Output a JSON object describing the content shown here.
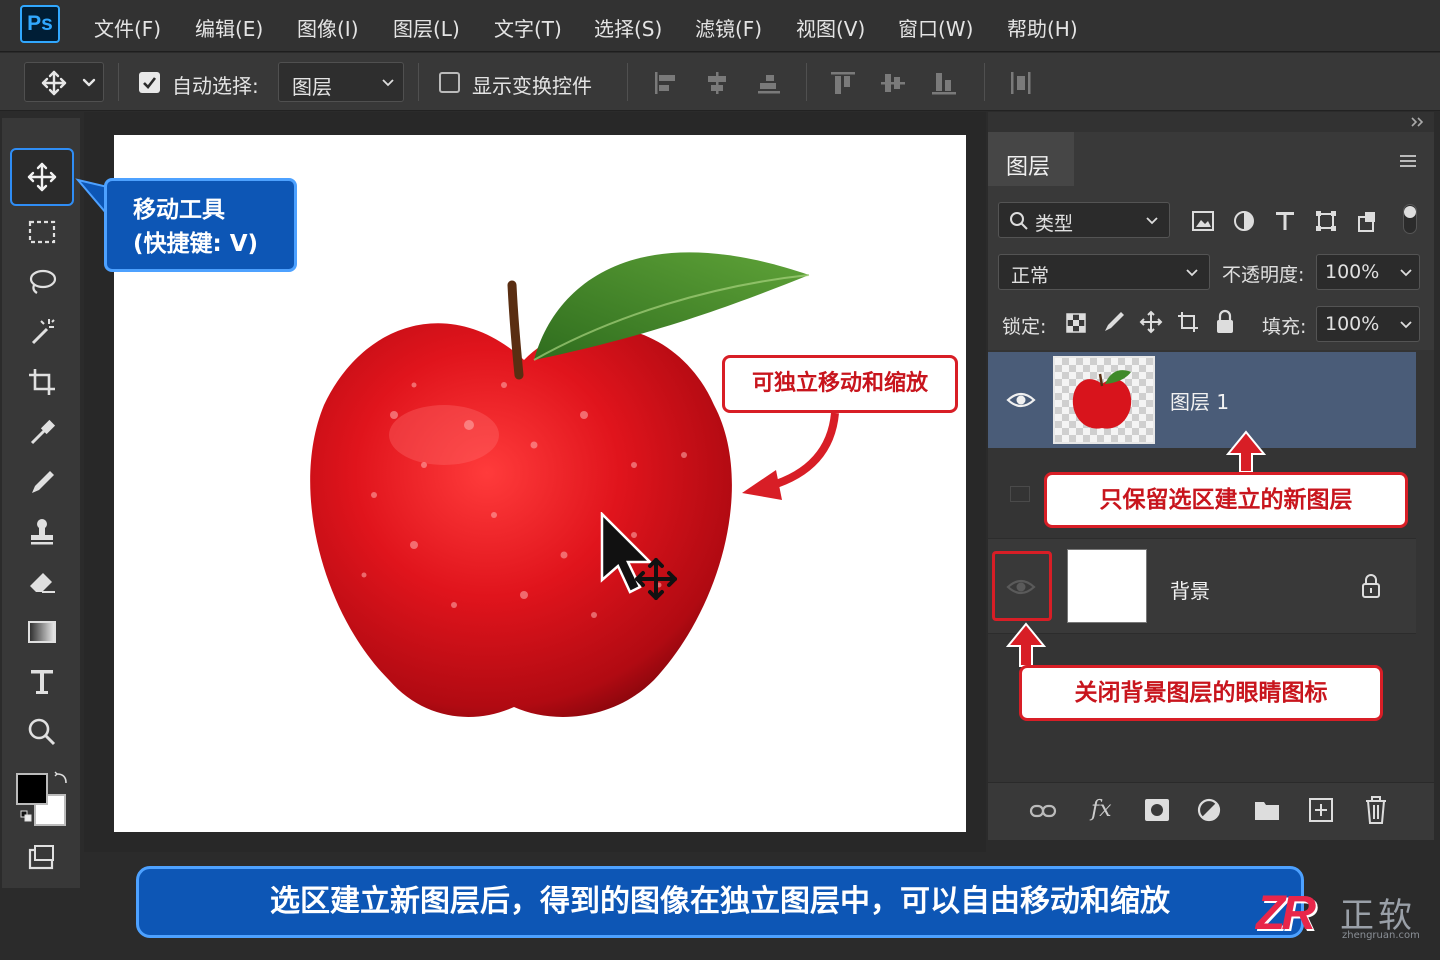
{
  "app": {
    "logo": "Ps"
  },
  "menu": [
    "文件(F)",
    "编辑(E)",
    "图像(I)",
    "图层(L)",
    "文字(T)",
    "选择(S)",
    "滤镜(F)",
    "视图(V)",
    "窗口(W)",
    "帮助(H)"
  ],
  "options": {
    "auto_select_label": "自动选择:",
    "auto_select_value": "图层",
    "show_transform_label": "显示变换控件"
  },
  "layers_panel": {
    "tab": "图层",
    "filter_label": "类型",
    "blend_mode": "正常",
    "opacity_label": "不透明度:",
    "opacity_value": "100%",
    "lock_label": "锁定:",
    "fill_label": "填充:",
    "fill_value": "100%",
    "layers": [
      {
        "name": "图层 1",
        "selected": true,
        "visible": true
      },
      {
        "name": "背景",
        "selected": false,
        "visible": false,
        "locked": true
      }
    ]
  },
  "annotations": {
    "move_tool_callout_line1": "移动工具",
    "move_tool_callout_line2": "(快捷键: V)",
    "independent_move": "可独立移动和缩放",
    "keep_selection_layer": "只保留选区建立的新图层",
    "close_bg_eye": "关闭背景图层的眼睛图标",
    "bottom_caption": "选区建立新图层后，得到的图像在独立图层中，可以自由移动和缩放"
  },
  "watermark": {
    "logo": "ZR",
    "text": "正软",
    "url": "zhengruan.com"
  },
  "colors": {
    "accent_blue": "#0d56b5",
    "accent_red": "#d81e26",
    "selected_layer": "#4a5c78"
  }
}
